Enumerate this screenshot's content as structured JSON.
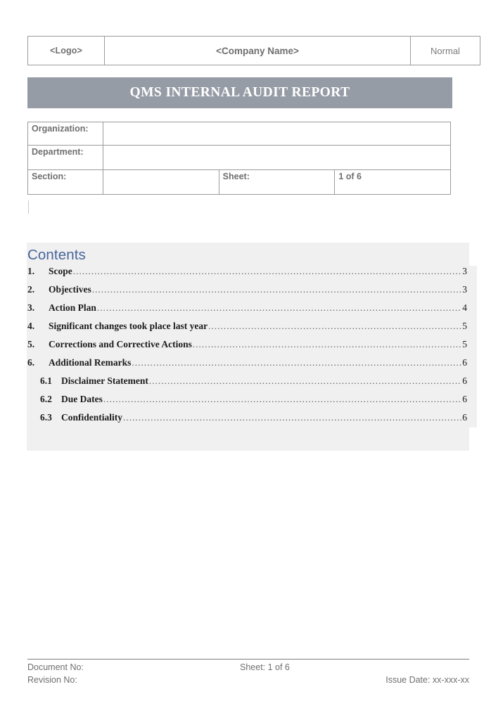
{
  "header_table": {
    "logo": "<Logo>",
    "company_name": "<Company Name>",
    "status": "Normal"
  },
  "title_banner": {
    "title": "QMS INTERNAL AUDIT REPORT",
    "background_color": "#969ca6",
    "text_color": "#ffffff"
  },
  "info_table": {
    "organization_label": "Organization:",
    "organization_value": "",
    "department_label": "Department:",
    "department_value": "",
    "section_label": "Section:",
    "section_value": "",
    "sheet_label": "Sheet:",
    "sheet_value": "1 of 6"
  },
  "contents": {
    "heading": "Contents",
    "heading_color": "#47659c",
    "background_color": "#f0f0f0",
    "entries": [
      {
        "number": "1.",
        "label": "Scope",
        "page": "3"
      },
      {
        "number": "2.",
        "label": "Objectives",
        "page": "3"
      },
      {
        "number": "3.",
        "label": "Action Plan",
        "page": "4"
      },
      {
        "number": "4.",
        "label": "Significant changes took place last year",
        "page": "5"
      },
      {
        "number": "5.",
        "label": "Corrections and Corrective Actions",
        "page": "5"
      },
      {
        "number": "6.",
        "label": "Additional Remarks",
        "page": "6"
      },
      {
        "number": "6.1",
        "label": "Disclaimer Statement",
        "page": "6"
      },
      {
        "number": "6.2",
        "label": "Due Dates",
        "page": "6"
      },
      {
        "number": "6.3",
        "label": "Confidentiality",
        "page": "6"
      }
    ]
  },
  "footer": {
    "document_no": "Document No:",
    "sheet": "Sheet: 1 of 6",
    "revision_no": "Revision No:",
    "issue_date": "Issue Date: xx-xxx-xx"
  }
}
